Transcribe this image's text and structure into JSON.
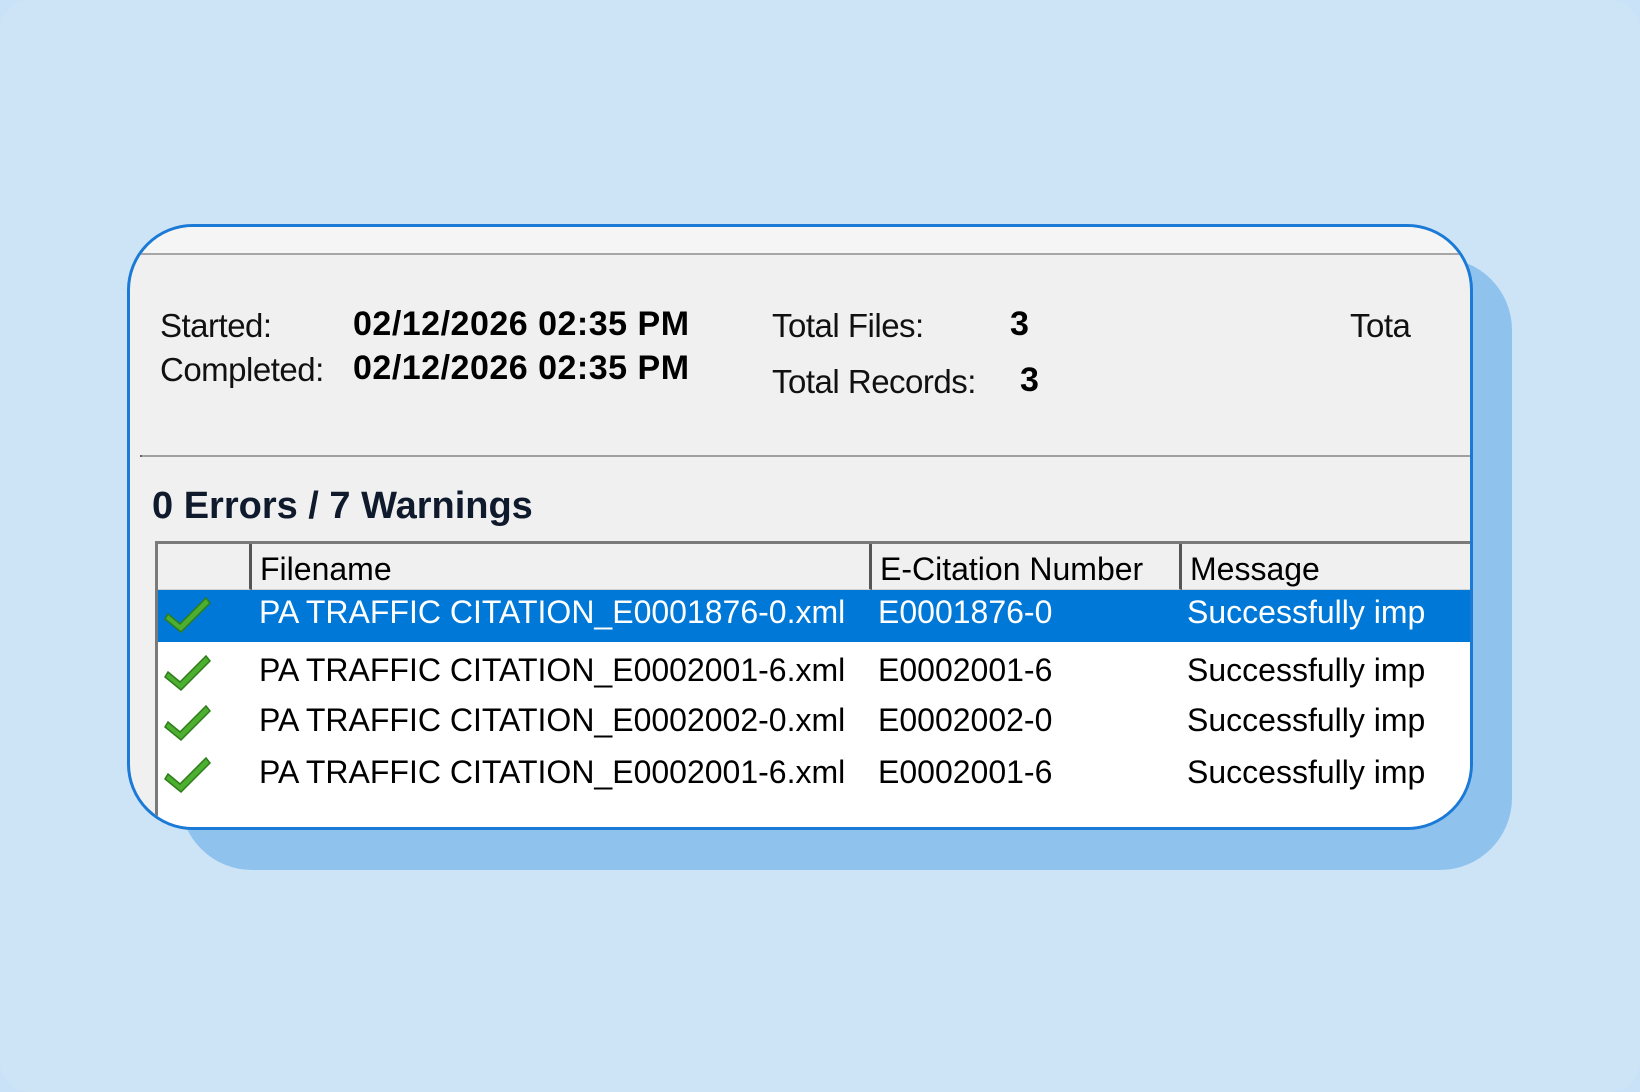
{
  "run": {
    "started_label": "Started:",
    "started_value": "02/12/2026 02:35 PM",
    "completed_label": "Completed:",
    "completed_value": "02/12/2026 02:35 PM",
    "total_files_label": "Total Files:",
    "total_files_value": "3",
    "total_records_label": "Total Records:",
    "total_records_value": "3",
    "cut_label": "Tota"
  },
  "summary": "0 Errors / 7 Warnings",
  "table": {
    "columns": [
      "",
      "Filename",
      "E-Citation Number",
      "Message"
    ],
    "rows": [
      {
        "icon": "green-check-icon",
        "filename": "PA TRAFFIC CITATION_E0001876-0.xml",
        "number": "E0001876-0",
        "message": "Successfully imp",
        "selected": true
      },
      {
        "icon": "green-check-icon",
        "filename": "PA TRAFFIC CITATION_E0002001-6.xml",
        "number": "E0002001-6",
        "message": "Successfully imp",
        "selected": false
      },
      {
        "icon": "green-check-icon",
        "filename": "PA TRAFFIC CITATION_E0002002-0.xml",
        "number": "E0002002-0",
        "message": "Successfully imp",
        "selected": false
      },
      {
        "icon": "green-check-icon",
        "filename": "PA TRAFFIC CITATION_E0002001-6.xml",
        "number": "E0002001-6",
        "message": "Successfully imp",
        "selected": false
      }
    ]
  },
  "colors": {
    "selection": "#0078d7",
    "frame_border": "#1a7ad6",
    "check_green": "#4caf2f"
  }
}
